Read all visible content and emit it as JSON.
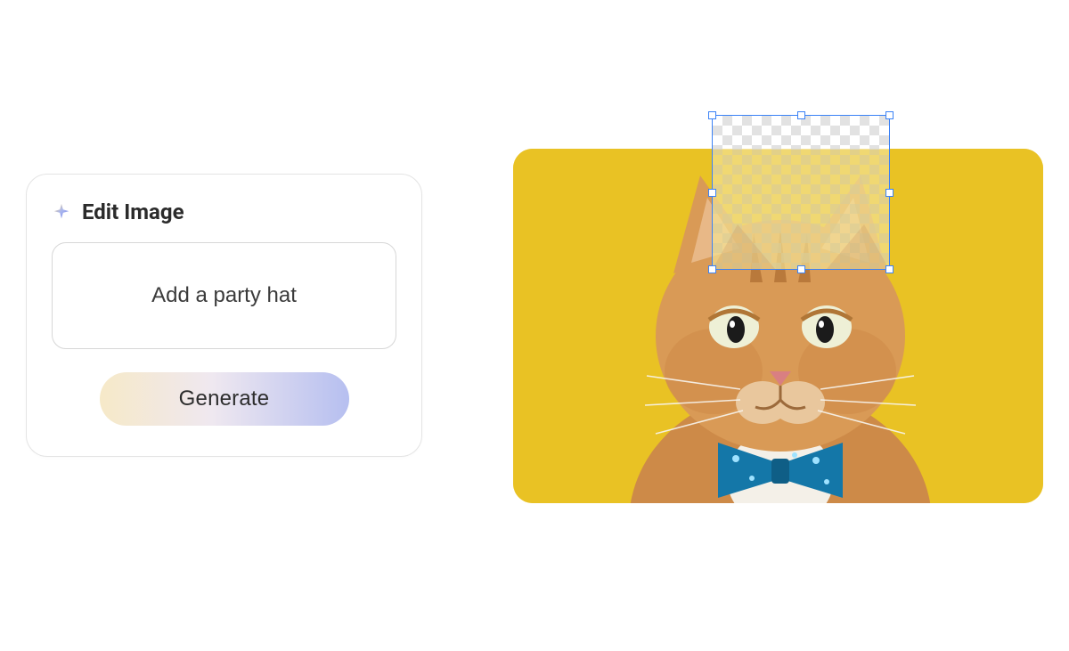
{
  "panel": {
    "title": "Edit Image",
    "prompt_value": "Add a party hat",
    "generate_label": "Generate"
  },
  "canvas": {
    "bg_color": "#e9c224",
    "subject": "orange-cat-with-blue-bowtie",
    "selection_label": "transparent-region"
  },
  "colors": {
    "selection_border": "#3b82f6"
  }
}
